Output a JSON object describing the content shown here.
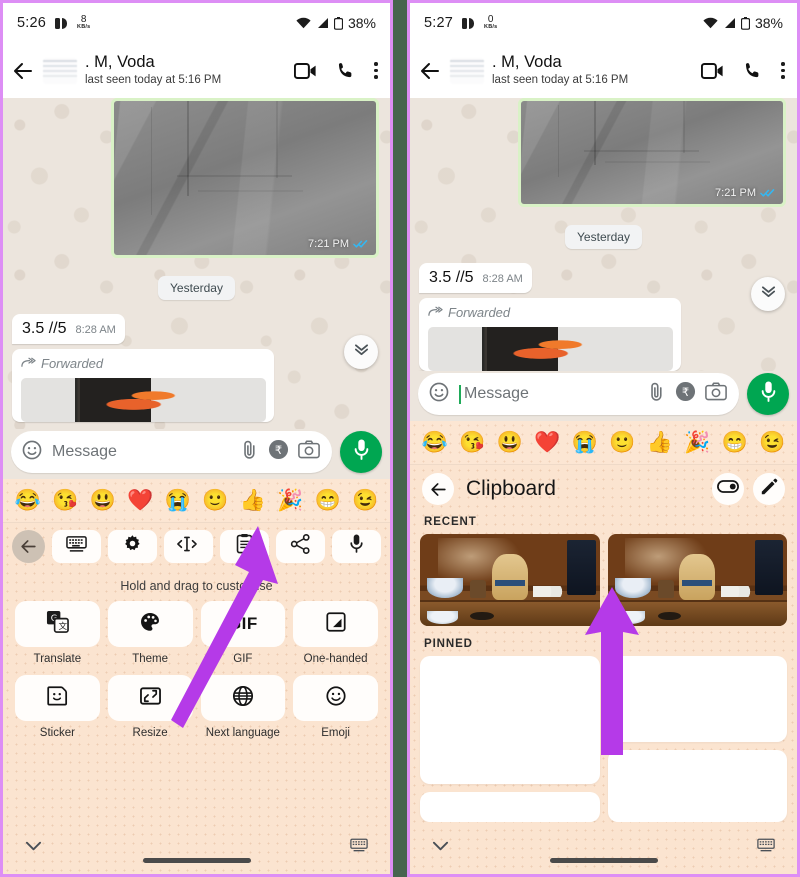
{
  "theme": {
    "frame_border": "#dd8ef5",
    "divider": "#47654f",
    "keyboard_bg": "#fbe4d0",
    "chat_bg": "#ece5dd",
    "accent_green": "#00a651",
    "arrow_purple": "#b53ae8",
    "tick_blue": "#34b7f1"
  },
  "left_panel": {
    "statusbar": {
      "time": "5:26",
      "net_speed_value": "8",
      "net_speed_unit": "KB/s",
      "battery": "38%",
      "icons": [
        "sim-card-icon",
        "wifi-icon",
        "signal-icon",
        "battery-icon"
      ]
    },
    "appbar": {
      "back_icon": "back-arrow-icon",
      "avatar": "contact-avatar",
      "contact_name": ". M, Voda",
      "contact_status": "last seen today at 5:16 PM",
      "video_call_icon": "video-call-icon",
      "voice_call_icon": "phone-call-icon",
      "overflow_icon": "kebab-menu-icon"
    },
    "chat": {
      "photo_timestamp": "7:21 PM",
      "read_receipt": "double-check-read-icon",
      "day_divider": "Yesterday",
      "message_text": "3.5 //5",
      "message_timestamp": "8:28 AM",
      "forwarded_label": "Forwarded",
      "forwarded_icon": "forwarded-arrow-icon",
      "scroll_down_icon": "double-chevron-down-icon"
    },
    "composer": {
      "emoji_icon": "emoji-face-icon",
      "placeholder": "Message",
      "attach_icon": "paperclip-icon",
      "payment_icon": "rupee-payment-icon",
      "camera_icon": "camera-icon",
      "mic_icon": "microphone-icon"
    },
    "emoji_row": [
      "😂",
      "😘",
      "😃",
      "❤️",
      "😭",
      "🙂",
      "👍",
      "🎉",
      "😁",
      "😉"
    ],
    "toolbar": {
      "back_icon": "back-arrow-icon",
      "items": [
        "keyboard-icon",
        "settings-gear-icon",
        "text-cursor-icon",
        "clipboard-icon",
        "share-icon",
        "microphone-icon"
      ]
    },
    "hint": "Hold and drag to customise",
    "grid": [
      {
        "label": "Translate",
        "icon": "translate-icon"
      },
      {
        "label": "Theme",
        "icon": "palette-icon"
      },
      {
        "label": "GIF",
        "icon": "gif-icon"
      },
      {
        "label": "One-handed",
        "icon": "one-handed-icon"
      },
      {
        "label": "Sticker",
        "icon": "sticker-icon"
      },
      {
        "label": "Resize",
        "icon": "resize-icon"
      },
      {
        "label": "Next language",
        "icon": "globe-icon"
      },
      {
        "label": "Emoji",
        "icon": "emoji-face-icon"
      }
    ],
    "footer": {
      "collapse_icon": "chevron-down-icon",
      "keyboard_icon": "keyboard-small-icon",
      "gesture_bar": "home-gesture-bar"
    },
    "annotation_arrow": "purple-arrow-pointing-to-clipboard-toolbar-button"
  },
  "right_panel": {
    "statusbar": {
      "time": "5:27",
      "net_speed_value": "0",
      "net_speed_unit": "KB/s",
      "battery": "38%",
      "icons": [
        "sim-card-icon",
        "wifi-icon",
        "signal-icon",
        "battery-icon"
      ]
    },
    "appbar": {
      "back_icon": "back-arrow-icon",
      "avatar": "contact-avatar",
      "contact_name": ". M, Voda",
      "contact_status": "last seen today at 5:16 PM",
      "video_call_icon": "video-call-icon",
      "voice_call_icon": "phone-call-icon",
      "overflow_icon": "kebab-menu-icon"
    },
    "chat": {
      "photo_timestamp": "7:21 PM",
      "read_receipt": "double-check-read-icon",
      "day_divider": "Yesterday",
      "message_text": "3.5 //5",
      "message_timestamp": "8:28 AM",
      "forwarded_label": "Forwarded",
      "forwarded_icon": "forwarded-arrow-icon",
      "scroll_down_icon": "double-chevron-down-icon"
    },
    "composer": {
      "emoji_icon": "emoji-face-icon",
      "placeholder": "Message",
      "attach_icon": "paperclip-icon",
      "payment_icon": "rupee-payment-icon",
      "camera_icon": "camera-icon",
      "mic_icon": "microphone-icon"
    },
    "emoji_row": [
      "😂",
      "😘",
      "😃",
      "❤️",
      "😭",
      "🙂",
      "👍",
      "🎉",
      "😁",
      "😉"
    ],
    "clipboard": {
      "back_icon": "back-arrow-icon",
      "title": "Clipboard",
      "toggle_icon": "toggle-switch-icon",
      "edit_icon": "pencil-edit-icon",
      "recent_label": "RECENT",
      "recent_items": [
        "clipboard-image-thumbnail",
        "clipboard-image-thumbnail"
      ],
      "pinned_label": "PINNED",
      "pinned_items": [
        "pinned-text-clip-blurred",
        "pinned-text-clip-blurred",
        "pinned-text-clip-blurred",
        "pinned-text-clip-blurred"
      ]
    },
    "footer": {
      "collapse_icon": "chevron-down-icon",
      "keyboard_icon": "keyboard-small-icon",
      "gesture_bar": "home-gesture-bar"
    },
    "annotation_arrow": "purple-arrow-pointing-to-recent-clipboard-image"
  }
}
